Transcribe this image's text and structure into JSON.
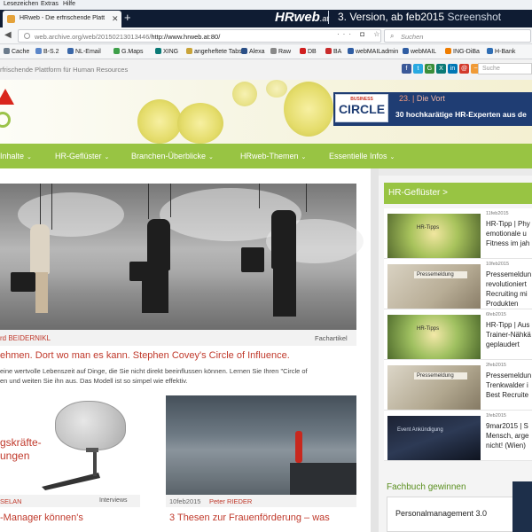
{
  "menubar": {
    "items": [
      "Lesezeichen",
      "Extras",
      "Hilfe"
    ]
  },
  "tab": {
    "title": "HRweb - Die erfrischende Platt"
  },
  "window_overlay": {
    "logo": "HRweb",
    "logo_suffix": ".at",
    "headline": "3. Version, ab feb2015",
    "screenshot_label": "Screenshot"
  },
  "navbar": {
    "url_gray": "web.archive.org/web/20150213013446/",
    "url_black": "http://www.hrweb.at:80/",
    "tools": "··· ◘ ☆",
    "search_placeholder": "Suchen"
  },
  "bookmarks": [
    {
      "label": "Cache",
      "color": "#6b7b8c"
    },
    {
      "label": "B-S.2",
      "color": "#5b86c9"
    },
    {
      "label": "NL-Email",
      "color": "#3a67a8"
    },
    {
      "label": "G.Maps",
      "color": "#3ea04a"
    },
    {
      "label": "XING",
      "color": "#0b7a76"
    },
    {
      "label": "angeheftete Tabs",
      "color": "#c9a43a"
    },
    {
      "label": "Alexa",
      "color": "#2a4f86"
    },
    {
      "label": "Raw",
      "color": "#888888"
    },
    {
      "label": "DB",
      "color": "#d01f1f"
    },
    {
      "label": "BA",
      "color": "#c92c2c"
    },
    {
      "label": "webMAILadmin",
      "color": "#2f5da3"
    },
    {
      "label": "webMAIL",
      "color": "#2f5da3"
    },
    {
      "label": "ING-DiBa",
      "color": "#ef7d00"
    },
    {
      "label": "H-Bank",
      "color": "#2f6eb4"
    }
  ],
  "site": {
    "tagline": "rfrischende Plattform für Human Resources",
    "search_placeholder": "Suche",
    "social": [
      {
        "glyph": "f",
        "color": "#3b5998"
      },
      {
        "glyph": "t",
        "color": "#29a9e1"
      },
      {
        "glyph": "G",
        "color": "#3a8e3a"
      },
      {
        "glyph": "X",
        "color": "#0b7a76"
      },
      {
        "glyph": "in",
        "color": "#0077b5"
      },
      {
        "glyph": "@",
        "color": "#d33a2c"
      },
      {
        "glyph": "~",
        "color": "#f09a36"
      },
      {
        "glyph": "▶",
        "color": "#cc181e"
      }
    ],
    "banner": {
      "brand_small": "BUSINESS",
      "brand": "CIRCLE",
      "line1_num": "23. |",
      "line1": "Die Vort",
      "line2": "30 hochkarätige HR-Experten aus de"
    },
    "nav": [
      "Inhalte",
      "HR-Geflüster",
      "Branchen-Überblicke",
      "HRweb-Themen",
      "Essentielle Infos"
    ]
  },
  "featured": {
    "author": "rd BEIDERNIKL",
    "category": "Fachartikel",
    "title": "ehmen. Dort wo man es kann. Stephen Covey's Circle of Influence.",
    "text_line1": "eine wertvolle Lebenszeit auf Dinge, die Sie nicht direkt beeinflussen können. Lernen Sie Ihren \"Circle of",
    "text_line2": "en und weiten Sie ihn aus. Das Modell ist so simpel wie effektiv."
  },
  "card1": {
    "big_line1": "gskräfte-",
    "big_line2": "ungen",
    "author": "SELAN",
    "category": "Interviews",
    "title": "-Manager können's"
  },
  "card2": {
    "date": "10feb2015",
    "author": "Peter RIEDER",
    "title": "3 Thesen zur Frauenförderung – was"
  },
  "sidebar": {
    "heading": "HR-Geflüster >",
    "items": [
      {
        "date": "11feb2015",
        "lines": [
          "HR-Tipp | Phy",
          "emotionale u",
          "Fitness im jah"
        ],
        "thumb_label": "HR-Tipps"
      },
      {
        "date": "10feb2015",
        "lines": [
          "Pressemeldun",
          "revolutioniert",
          "Recruiting mi",
          "Produkten"
        ],
        "thumb_label": "Pressemeldung"
      },
      {
        "date": "6feb2015",
        "lines": [
          "HR-Tipp | Aus",
          "Trainer-Nähkä",
          "geplaudert"
        ],
        "thumb_label": "HR-Tipps"
      },
      {
        "date": "2feb2015",
        "lines": [
          "Pressemeldun",
          "Trenkwalder i",
          "Best Recruite"
        ],
        "thumb_label": "Pressemeldung"
      },
      {
        "date": "1feb2015",
        "lines": [
          "9mar2015 | S",
          "Mensch, arge",
          "nicht! (Wien)"
        ],
        "thumb_label": "Event Ankündigung"
      }
    ],
    "fachbuch_heading": "Fachbuch gewinnen",
    "fachbuch_title": "Personalmanagement 3.0"
  }
}
